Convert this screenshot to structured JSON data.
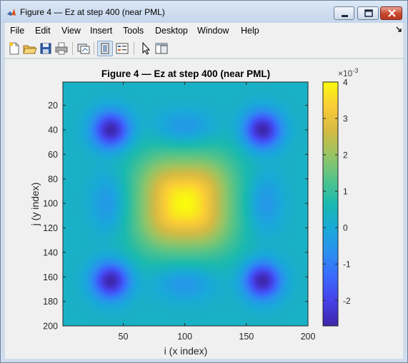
{
  "window": {
    "title": "Figure 4 — Ez at step 400 (near PML)",
    "buttons": [
      "minimize",
      "maximize",
      "close"
    ]
  },
  "menubar": {
    "items": [
      "File",
      "Edit",
      "View",
      "Insert",
      "Tools",
      "Desktop",
      "Window",
      "Help"
    ]
  },
  "toolbar": {
    "icons": [
      "new-figure-icon",
      "open-file-icon",
      "save-icon",
      "print-icon",
      "link-plot-icon",
      "dock-toggle-icon",
      "insert-legend-icon",
      "select-arrow-icon",
      "property-inspector-icon"
    ]
  },
  "chart_data": {
    "type": "heatmap",
    "title": "Figure 4 — Ez at step 400 (near PML)",
    "xlabel": "i (x index)",
    "ylabel": "j (y index)",
    "xlim": [
      1,
      200
    ],
    "ylim": [
      1,
      200
    ],
    "y_reversed": true,
    "xticks": [
      50,
      100,
      150,
      200
    ],
    "yticks": [
      20,
      40,
      60,
      80,
      100,
      120,
      140,
      160,
      180,
      200
    ],
    "colormap": "parula",
    "colorbar": {
      "multiplier": "×10",
      "exponent": "-3",
      "clim": [
        -2.7,
        4.0
      ],
      "ticks": [
        4,
        3,
        2,
        1,
        0,
        -1,
        -2
      ]
    },
    "features": [
      {
        "kind": "peak",
        "x": 100,
        "y": 100,
        "value": 4.0
      },
      {
        "kind": "trough",
        "x": 40,
        "y": 40,
        "value": -2.7
      },
      {
        "kind": "trough",
        "x": 163,
        "y": 40,
        "value": -2.7
      },
      {
        "kind": "trough",
        "x": 40,
        "y": 163,
        "value": -2.7
      },
      {
        "kind": "trough",
        "x": 163,
        "y": 163,
        "value": -2.7
      }
    ],
    "background_value": 0.3
  }
}
